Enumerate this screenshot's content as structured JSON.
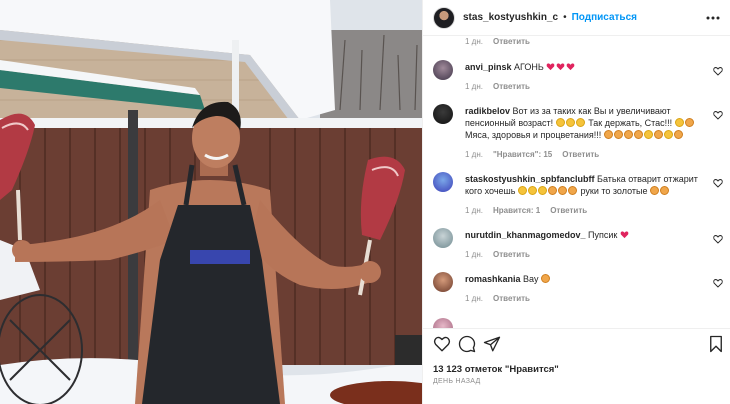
{
  "post": {
    "username": "stas_kostyushkin_c",
    "separator": "•",
    "follow_label": "Подписаться"
  },
  "comments": [
    {
      "user": "",
      "text": "",
      "time": "1 дн.",
      "likes": "",
      "reply": "Ответить"
    },
    {
      "user": "anvi_pinsk",
      "text": "АГОНЬ",
      "time": "1 дн.",
      "likes": "",
      "reply": "Ответить"
    },
    {
      "user": "radikbelov",
      "text": "Вот из за таких как Вы и увеличивают пенсионный возраст!",
      "text2": "Так держать, Стас!!!",
      "text3": "Мяса, здоровья и процветания!!!",
      "time": "1 дн.",
      "likes": "\"Нравится\": 15",
      "reply": "Ответить"
    },
    {
      "user": "staskostyushkin_spbfanclubff",
      "text": "Батька отварит отжарит кого хочешь",
      "text2": "руки то золотые",
      "time": "1 дн.",
      "likes": "Нравится: 1",
      "reply": "Ответить"
    },
    {
      "user": "nurutdin_khanmagomedov_",
      "text": "Пупсик",
      "time": "1 дн.",
      "likes": "",
      "reply": "Ответить"
    },
    {
      "user": "romashkania",
      "text": "Вау",
      "time": "1 дн.",
      "likes": "",
      "reply": "Ответить"
    }
  ],
  "footer": {
    "likes_text": "13 123 отметок \"Нравится\"",
    "time_ago": "ДЕНЬ НАЗАД"
  },
  "icons": {
    "more": "more-icon",
    "like": "heart-icon",
    "comment": "comment-icon",
    "share": "share-icon",
    "save": "bookmark-icon"
  },
  "colors": {
    "follow": "#0095f6",
    "meta": "#8e8e8e",
    "text": "#262626"
  }
}
